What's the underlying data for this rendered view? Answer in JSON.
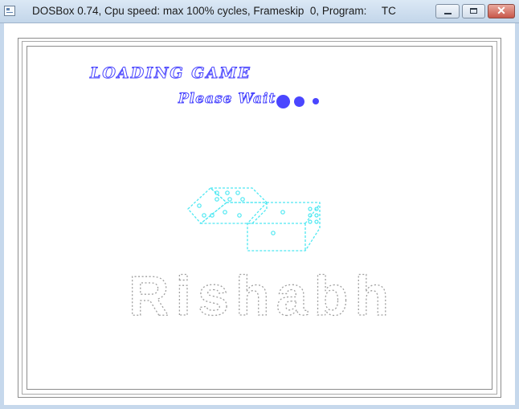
{
  "window": {
    "title": "DOSBox 0.74, Cpu speed: max 100% cycles, Frameskip  0, Program:     TC",
    "close_glyph": "✕"
  },
  "screen": {
    "loading_text": "LOADING GAME",
    "wait_text": "Please Wait",
    "banner_text": "Rishabh",
    "colors": {
      "title_blue": "#4a46ff",
      "dice_cyan": "#4fe8f2",
      "banner_gray": "#a0a0a0",
      "frame_gray": "#8c8c8c"
    }
  }
}
